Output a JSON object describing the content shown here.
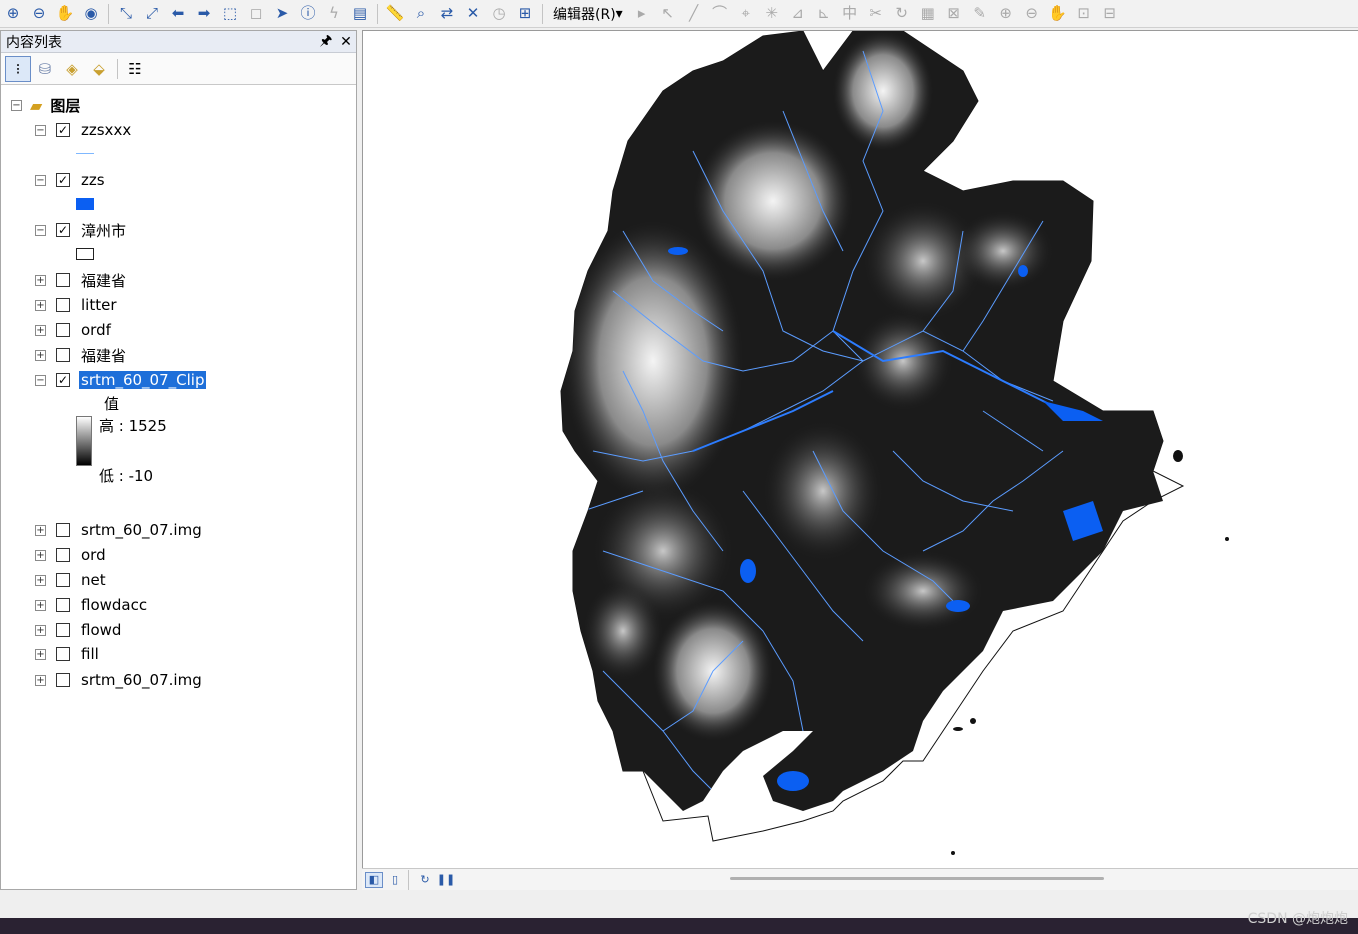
{
  "toolbar": {
    "editor_label": "编辑器(R)",
    "editor_arrow": "▾"
  },
  "toc": {
    "title": "内容列表",
    "pin_icon": "ᵖ",
    "close_icon": "✕",
    "root_label": "图层",
    "layers": [
      {
        "name": "zzsxxx",
        "checked": true,
        "expanded": true
      },
      {
        "name": "zzs",
        "checked": true,
        "expanded": true
      },
      {
        "name": "漳州市",
        "checked": true,
        "expanded": true
      },
      {
        "name": "福建省",
        "checked": false,
        "expanded": false
      },
      {
        "name": "litter",
        "checked": false,
        "expanded": false
      },
      {
        "name": "ordf",
        "checked": false,
        "expanded": false
      },
      {
        "name": "福建省",
        "checked": false,
        "expanded": false
      },
      {
        "name": "srtm_60_07_Clip",
        "checked": true,
        "expanded": true,
        "selected": true
      },
      {
        "name": "srtm_60_07.img",
        "checked": false,
        "expanded": false
      },
      {
        "name": "ord",
        "checked": false,
        "expanded": false
      },
      {
        "name": "net",
        "checked": false,
        "expanded": false
      },
      {
        "name": "flowdacc",
        "checked": false,
        "expanded": false
      },
      {
        "name": "flowd",
        "checked": false,
        "expanded": false
      },
      {
        "name": "fill",
        "checked": false,
        "expanded": false
      },
      {
        "name": "srtm_60_07.img",
        "checked": false,
        "expanded": false
      }
    ],
    "legend": {
      "value_heading": "值",
      "high_label": "高 : 1525",
      "low_label": "低 : -10"
    }
  },
  "colors": {
    "selection": "#1e6fd9",
    "water": "#0b5ff2",
    "stream": "#7fb8ff"
  },
  "watermark": "CSDN @炮炮炮"
}
